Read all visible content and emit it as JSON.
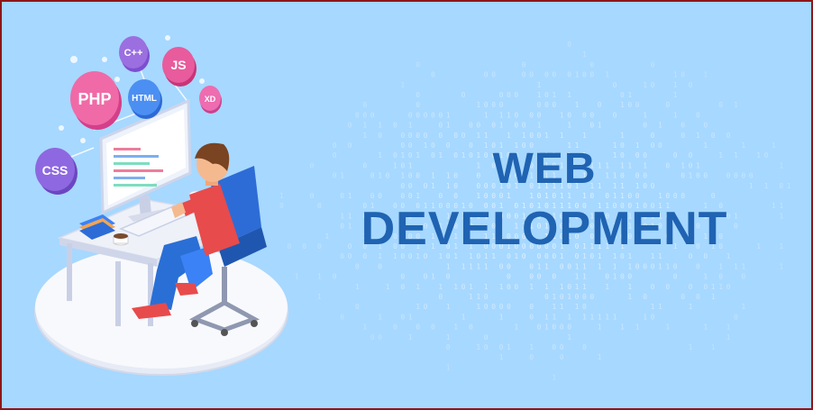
{
  "banner": {
    "title_line1": "WEB",
    "title_line2": "DEVELOPMENT"
  },
  "tech_badges": {
    "cpp": "C++",
    "js": "JS",
    "php": "PHP",
    "html": "HTML",
    "xd": "XD",
    "css": "CSS"
  },
  "colors": {
    "background": "#a7d8ff",
    "title": "#1f63b2",
    "border": "#8f1518",
    "badge_pink": "#e04a8f",
    "badge_purple": "#8f63d8",
    "badge_blue": "#3b82f6"
  }
}
